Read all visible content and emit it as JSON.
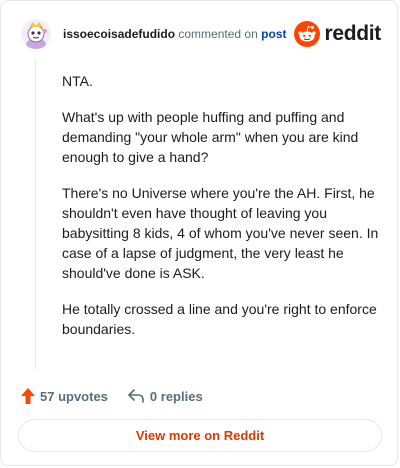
{
  "header": {
    "username": "issoecoisadefudido",
    "action_text": "commented on",
    "post_link": "post",
    "brand": "reddit"
  },
  "comment": {
    "paragraphs": [
      "NTA.",
      "What's up with people huffing and puffing and demanding \"your whole arm\" when you are kind enough to give a hand?",
      "There's no Universe where you're the AH. First, he shouldn't even have thought of leaving you babysitting 8 kids, 4 of whom you've never seen. In case of a lapse of judgment, the very least he should've done is ASK.",
      "He totally crossed a line and you're right to enforce boundaries."
    ]
  },
  "actions": {
    "upvotes": "57 upvotes",
    "replies": "0 replies"
  },
  "footer": {
    "view_more": "View more on Reddit"
  },
  "colors": {
    "brand_orange": "#ff4500",
    "link_blue": "#0045ac",
    "view_more_text": "#d93a00",
    "muted": "#576f76"
  }
}
